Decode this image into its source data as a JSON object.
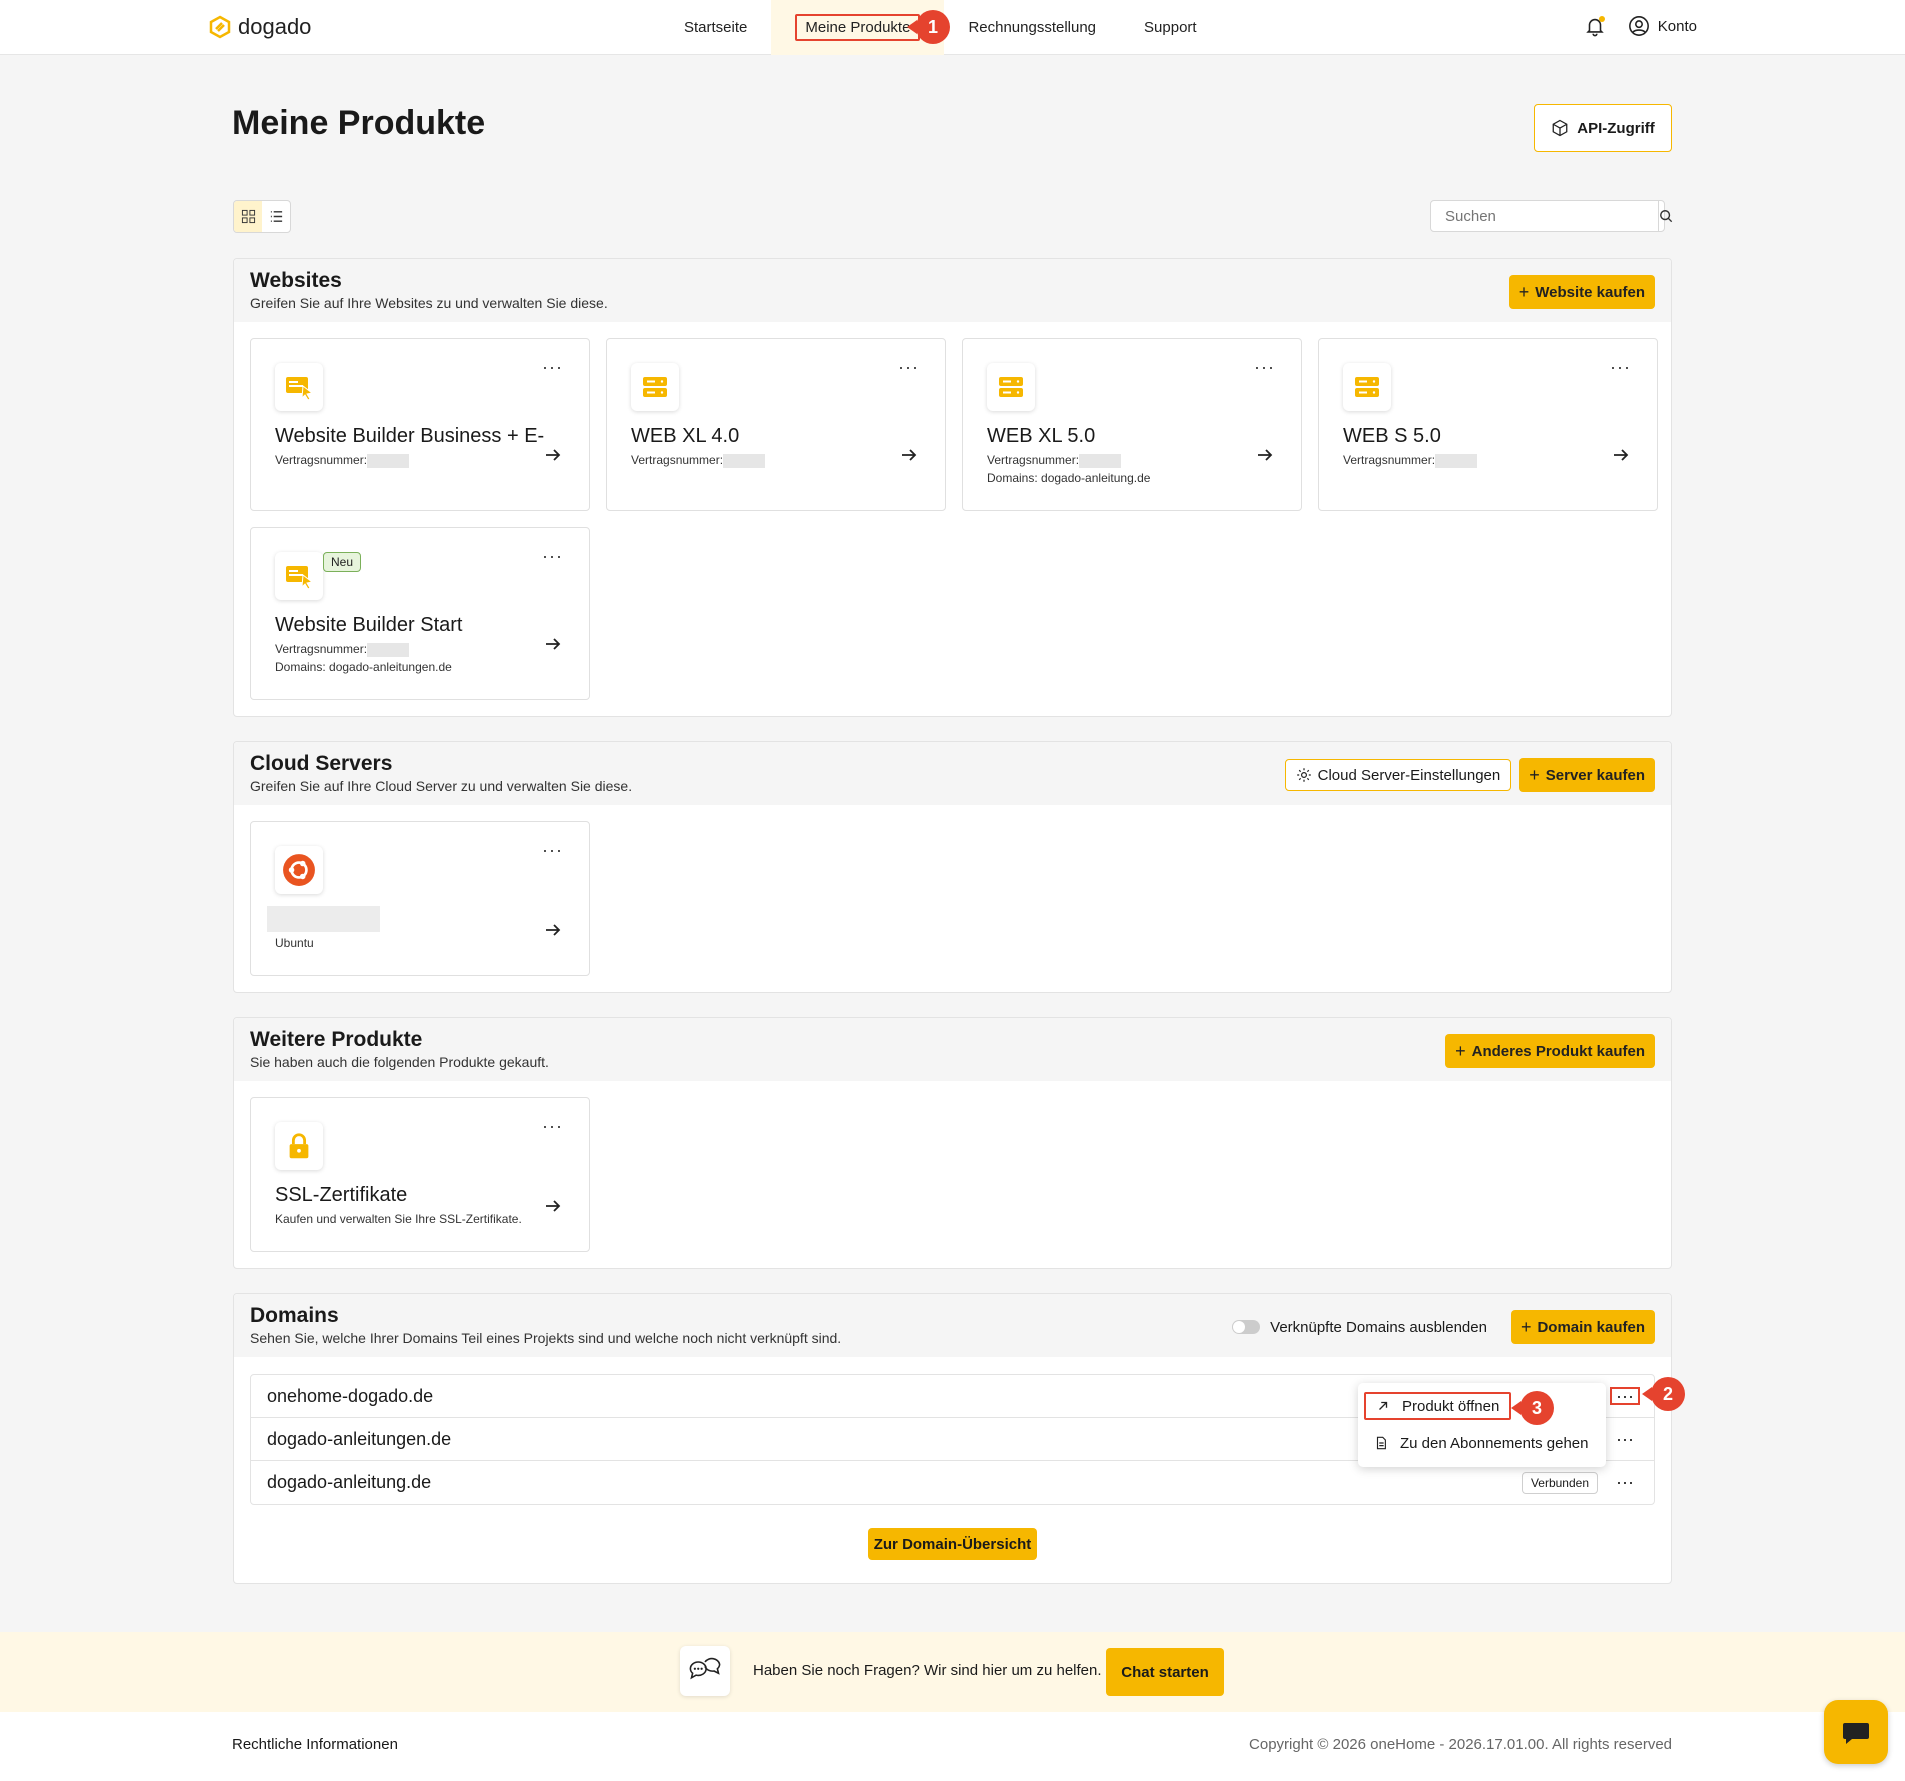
{
  "header": {
    "logo": "dogado",
    "nav": [
      "Startseite",
      "Meine Produkte",
      "Rechnungsstellung",
      "Support"
    ],
    "account": "Konto"
  },
  "callouts": [
    "1",
    "2",
    "3"
  ],
  "page": {
    "title": "Meine Produkte",
    "api_button": "API-Zugriff",
    "search_placeholder": "Suchen"
  },
  "websites": {
    "title": "Websites",
    "subtitle": "Greifen Sie auf Ihre Websites zu und verwalten Sie diese.",
    "buy_button": "Website kaufen",
    "cards": [
      {
        "name": "Website Builder Business + E-…",
        "contract_label": "Vertragsnummer:",
        "domains": ""
      },
      {
        "name": "WEB XL 4.0",
        "contract_label": "Vertragsnummer:",
        "domains": ""
      },
      {
        "name": "WEB XL 5.0",
        "contract_label": "Vertragsnummer:",
        "domains": "Domains: dogado-anleitung.de"
      },
      {
        "name": "WEB S 5.0",
        "contract_label": "Vertragsnummer:",
        "domains": ""
      },
      {
        "name": "Website Builder Start",
        "badge": "Neu",
        "contract_label": "Vertragsnummer:",
        "domains": "Domains: dogado-anleitungen.de"
      }
    ]
  },
  "cloud": {
    "title": "Cloud Servers",
    "subtitle": "Greifen Sie auf Ihre Cloud Server zu und verwalten Sie diese.",
    "settings_button": "Cloud Server-Einstellungen",
    "buy_button": "Server kaufen",
    "cards": [
      {
        "os": "Ubuntu"
      }
    ]
  },
  "more": {
    "title": "Weitere Produkte",
    "subtitle": "Sie haben auch die folgenden Produkte gekauft.",
    "buy_button": "Anderes Produkt kaufen",
    "cards": [
      {
        "name": "SSL-Zertifikate",
        "desc": "Kaufen und verwalten Sie Ihre SSL-Zertifikate."
      }
    ]
  },
  "domains": {
    "title": "Domains",
    "subtitle": "Sehen Sie, welche Ihrer Domains Teil eines Projekts sind und welche noch nicht verknüpft sind.",
    "toggle_label": "Verknüpfte Domains ausblenden",
    "buy_button": "Domain kaufen",
    "rows": [
      {
        "name": "onehome-dogado.de",
        "status": ""
      },
      {
        "name": "dogado-anleitungen.de",
        "status": ""
      },
      {
        "name": "dogado-anleitung.de",
        "status": "Verbunden"
      }
    ],
    "menu": [
      "Produkt öffnen",
      "Zu den Abonnements gehen"
    ],
    "overview_button": "Zur Domain-Übersicht"
  },
  "chat": {
    "text": "Haben Sie noch Fragen? Wir sind hier um zu helfen.",
    "button": "Chat starten"
  },
  "footer": {
    "left": "Rechtliche Informationen",
    "right": "Copyright © 2026 oneHome - 2026.17.01.00. All rights reserved"
  }
}
